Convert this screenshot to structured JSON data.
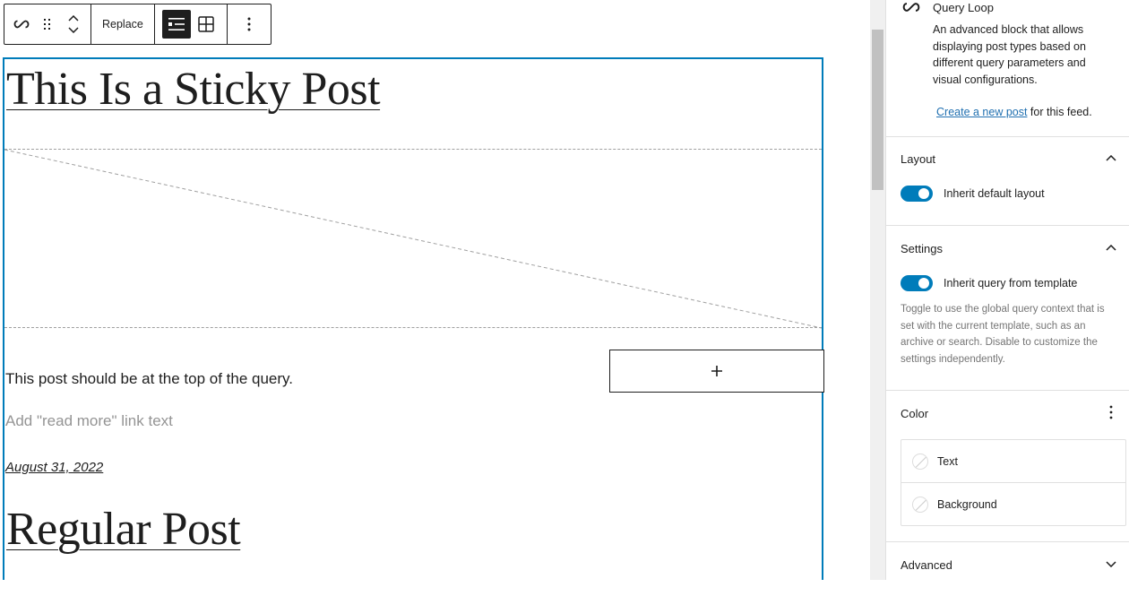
{
  "toolbar": {
    "block_icon": "query-loop-icon",
    "drag_icon": "drag-handle-icon",
    "move_icon": "chevron-up-down-icon",
    "replace_label": "Replace",
    "list_view_icon": "list-view-icon",
    "grid_view_icon": "grid-view-icon",
    "more_icon": "more-vertical-icon"
  },
  "canvas": {
    "posts": [
      {
        "title": "This Is a Sticky Post",
        "featured_image": "placeholder",
        "excerpt": "This post should be at the top of the query.",
        "read_more_placeholder": "Add \"read more\" link text",
        "date": "August 31, 2022"
      },
      {
        "title": "Regular Post"
      }
    ],
    "appender_icon": "plus-icon",
    "appender_label": "+"
  },
  "sidebar": {
    "block_card": {
      "icon": "query-loop-icon",
      "title": "Query Loop",
      "description": "An advanced block that allows displaying post types based on different query parameters and visual configurations.",
      "link_text": "Create a new post",
      "link_suffix": " for this feed."
    },
    "panels": {
      "layout": {
        "title": "Layout",
        "expanded": true,
        "toggle_label": "Inherit default layout",
        "toggle_on": true
      },
      "settings": {
        "title": "Settings",
        "expanded": true,
        "toggle_label": "Inherit query from template",
        "toggle_on": true,
        "help": "Toggle to use the global query context that is set with the current template, such as an archive or search. Disable to customize the settings independently."
      },
      "color": {
        "title": "Color",
        "items": [
          {
            "label": "Text"
          },
          {
            "label": "Background"
          }
        ]
      },
      "advanced": {
        "title": "Advanced",
        "expanded": false
      }
    }
  },
  "colors": {
    "accent": "#007cba",
    "link": "#2271b1",
    "text": "#1e1e1e",
    "muted": "#757575"
  }
}
